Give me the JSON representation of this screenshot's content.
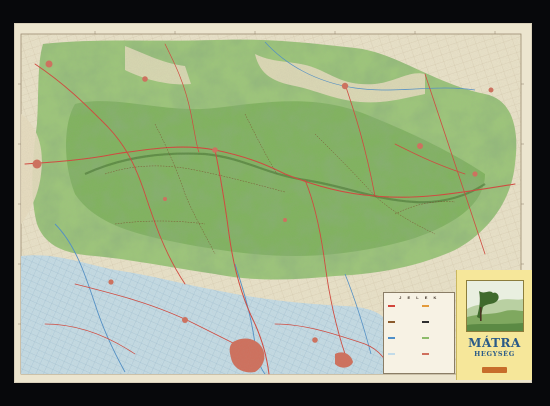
{
  "map": {
    "region": "Mátra",
    "colors": {
      "border": "#07080b",
      "paper": "#f2ead8",
      "forest": "#8dbb6a",
      "forest_dark": "#5f9a46",
      "lowland": "#c2dbe8",
      "fields": "#e9e2c9",
      "roads": "#d2453b",
      "towns": "#cf6f5c",
      "water": "#4e8fc8"
    }
  },
  "header_notes": [
    "",
    "",
    "",
    "",
    ""
  ],
  "legend": {
    "title": "J E L E K",
    "rows": [
      {
        "label": "",
        "color": "#d2453b"
      },
      {
        "label": "",
        "color": "#e39a3a"
      },
      {
        "label": "",
        "color": "#8b5a2b"
      },
      {
        "label": "",
        "color": "#2f2f2f"
      },
      {
        "label": "",
        "color": "#4e8fc8"
      },
      {
        "label": "",
        "color": "#8dbb6a"
      },
      {
        "label": "",
        "color": "#c2dbe8"
      },
      {
        "label": "",
        "color": "#cf6f5c"
      }
    ]
  },
  "cover": {
    "title": "MÁTRA",
    "subtitle": "HEGYSÉG",
    "tagline": "",
    "badge_color": "#c76d2a"
  },
  "footer": {
    "left": "",
    "mid": "",
    "scale": ""
  }
}
